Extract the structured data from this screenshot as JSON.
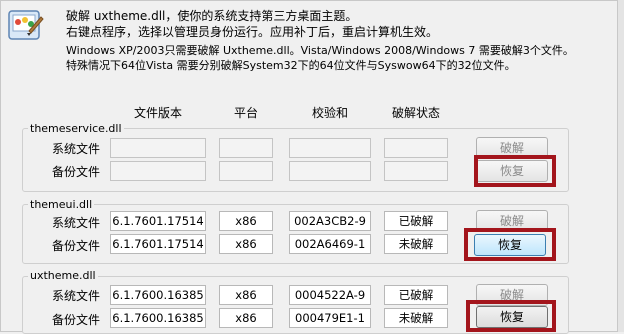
{
  "intro": {
    "line1": "破解 uxtheme.dll，使你的系统支持第三方桌面主题。",
    "line2": "右键点程序，选择以管理员身份运行。应用补丁后，重启计算机生效。"
  },
  "notes": {
    "line1": "Windows XP/2003只需要破解 Uxtheme.dll。Vista/Windows 2008/Windows 7 需要破解3个文件。",
    "line2": "特殊情况下64位Vista 需要分别破解System32下的64位文件与Syswow64下的32位文件。"
  },
  "columns": [
    "文件版本",
    "平台",
    "校验和",
    "破解状态"
  ],
  "row_labels": {
    "system": "系统文件",
    "backup": "备份文件"
  },
  "buttons": {
    "crack": "破解",
    "restore": "恢复"
  },
  "groups": [
    {
      "title": "themeservice.dll",
      "system": {
        "version": "",
        "platform": "",
        "checksum": "",
        "status": ""
      },
      "backup": {
        "version": "",
        "platform": "",
        "checksum": "",
        "status": ""
      }
    },
    {
      "title": "themeui.dll",
      "system": {
        "version": "6.1.7601.17514",
        "platform": "x86",
        "checksum": "002A3CB2-9",
        "status": "已破解"
      },
      "backup": {
        "version": "6.1.7601.17514",
        "platform": "x86",
        "checksum": "002A6469-1",
        "status": "未破解"
      }
    },
    {
      "title": "uxtheme.dll",
      "system": {
        "version": "6.1.7600.16385",
        "platform": "x86",
        "checksum": "0004522A-9",
        "status": "已破解"
      },
      "backup": {
        "version": "6.1.7600.16385",
        "platform": "x86",
        "checksum": "000479E1-1",
        "status": "未破解"
      }
    }
  ],
  "colors": {
    "highlight": "#a3151c",
    "focus_button": "#bee6fd",
    "window_bg": "#f0f0f0"
  }
}
